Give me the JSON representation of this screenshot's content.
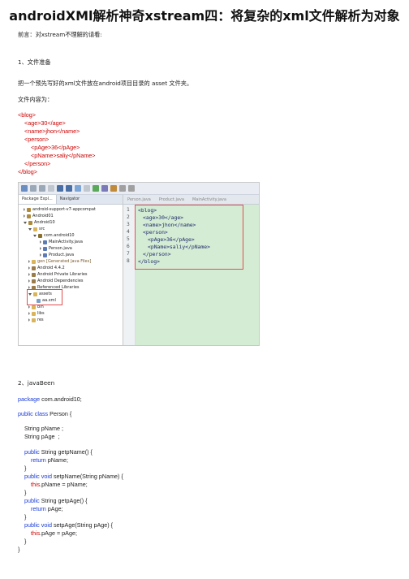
{
  "title": "androidXMl解析神奇xstream四：将复杂的xml文件解析为对象",
  "preface": "前言：对xstream不理解的请看:",
  "section1": "1、文件准备",
  "para1": "把一个预先写好的xml文件放在android项目目录的 asset 文件夹。",
  "para2": "文件内容为：",
  "xml_lines": [
    "<blog>",
    "<age>30</age>",
    "<name>jhon</name>",
    "<person>",
    "<pAge>36</pAge>",
    "<pName>saliy</pName>",
    "</person>",
    "</blog>"
  ],
  "ide": {
    "left_tabs": [
      "Package Expl...",
      "Navigator"
    ],
    "editor_tabs": [
      "Person.java",
      "Product.java",
      "MainActivity.java"
    ],
    "tree": [
      "android-support-v7-appcompat",
      "Android01",
      "Android10",
      "src",
      "com.android10",
      "MainActivity.java",
      "Person.java",
      "Product.java",
      "gen [Generated Java Files]",
      "Android 4.4.2",
      "Android Private Libraries",
      "Android Dependencies",
      "Referenced Libraries",
      "assets",
      "aa.xml",
      "bin",
      "libs",
      "res"
    ],
    "line_numbers": [
      "1",
      "2",
      "3",
      "4",
      "5",
      "6",
      "7",
      "8"
    ],
    "code": [
      "<blog>",
      "<age>30</age>",
      "<name>jhon</name>",
      "<person>",
      "<pAge>36</pAge>",
      "<pName>saliy</pName>",
      "</person>",
      "</blog>"
    ]
  },
  "section2": "2、javaBeen",
  "java": {
    "l1_kw": "package",
    "l1_rest": " com.android10;",
    "l2_kw": "public class",
    "l2_rest": " Person {",
    "l3": "String pName ;",
    "l4": "String pAge  ;",
    "l5_kw": "public",
    "l5_rest": " String getpName() {",
    "l6_kw": "return",
    "l6_rest": " pName;",
    "l7": "}",
    "l8_kw": "public void",
    "l8_rest": " setpName(String pName) {",
    "l9_kw": "this",
    "l9_rest": ".pName = pName;",
    "l10": "}",
    "l11_kw": "public",
    "l11_rest": " String getpAge() {",
    "l12_kw": "return",
    "l12_rest": " pAge;",
    "l13": "}",
    "l14_kw": "public void",
    "l14_rest": " setpAge(String pAge) {",
    "l15_kw": "this",
    "l15_rest": ".pAge = pAge;",
    "l16": "}",
    "l17": "}"
  }
}
